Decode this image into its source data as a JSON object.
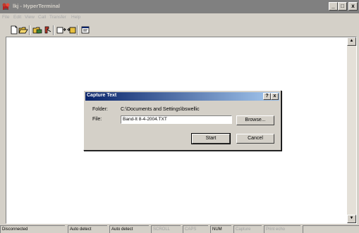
{
  "window": {
    "title": "lkj - HyperTerminal",
    "controls": {
      "minimize": "_",
      "maximize": "□",
      "close": "x"
    }
  },
  "menu": {
    "items": [
      "File",
      "Edit",
      "View",
      "Call",
      "Transfer",
      "Help"
    ]
  },
  "toolbar": {
    "icons": [
      "new-icon",
      "open-icon",
      "dial-icon",
      "disconnect-icon",
      "send-icon",
      "receive-icon",
      "properties-icon"
    ]
  },
  "dialog": {
    "title": "Capture Text",
    "help_label": "?",
    "close_label": "x",
    "folder_label": "Folder:",
    "folder_value": "C:\\Documents and Settings\\bswellic",
    "file_label": "File:",
    "file_value": "Band-It 8-4-2004.TXT",
    "browse_label": "Browse...",
    "start_label": "Start",
    "cancel_label": "Cancel"
  },
  "statusbar": {
    "connection": "Disconnected",
    "detect1": "Auto detect",
    "detect2": "Auto detect",
    "scroll": "SCROLL",
    "caps": "CAPS",
    "num": "NUM",
    "capture": "Capture",
    "print_echo": "Print echo"
  },
  "colors": {
    "face": "#d4d0c8",
    "inactive_title": "#808080",
    "active_title_start": "#0a246a",
    "active_title_end": "#a6caf0"
  }
}
